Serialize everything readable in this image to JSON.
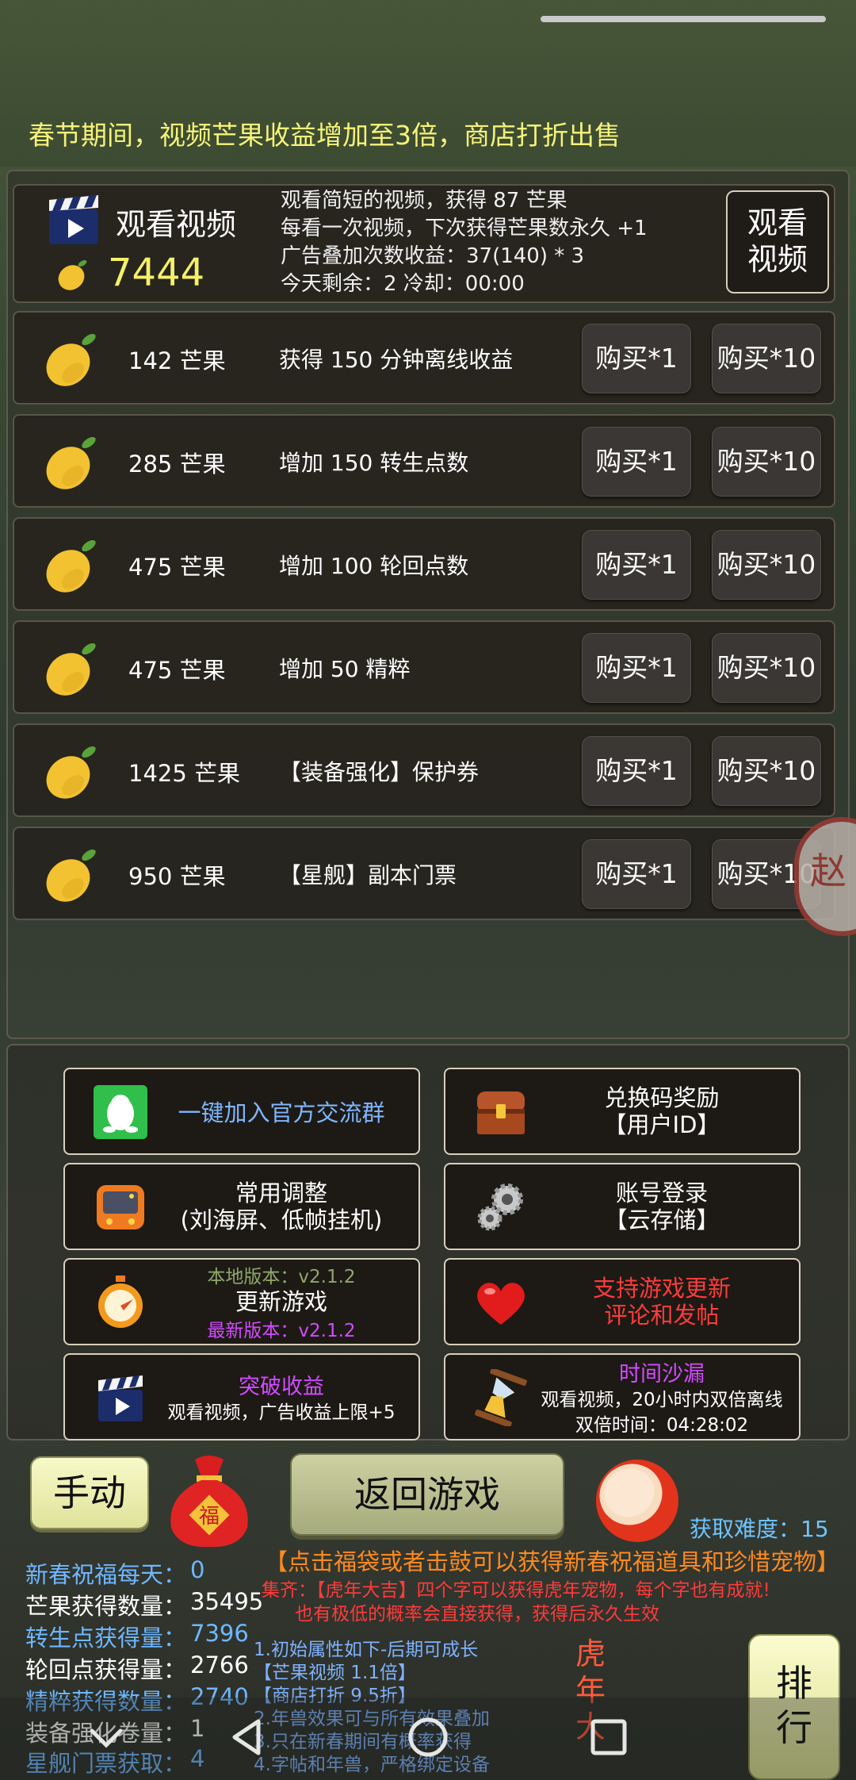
{
  "announcement": "春节期间，视频芒果收益增加至3倍，商店打折出售",
  "video": {
    "title": "观看视频",
    "mango_count": "7444",
    "lines": [
      "观看简短的视频，获得 87 芒果",
      "每看一次视频，下次获得芒果数永久 +1",
      "广告叠加次数收益：37(140) * 3",
      "今天剩余：2    冷却：00:00"
    ],
    "button_lines": [
      "观看",
      "视频"
    ]
  },
  "shop": [
    {
      "price": "142 芒果",
      "effect": "获得 150 分钟离线收益",
      "buy1": "购买*1",
      "buy10": "购买*10"
    },
    {
      "price": "285 芒果",
      "effect": "增加 150 转生点数",
      "buy1": "购买*1",
      "buy10": "购买*10"
    },
    {
      "price": "475 芒果",
      "effect": "增加 100 轮回点数",
      "buy1": "购买*1",
      "buy10": "购买*10"
    },
    {
      "price": "475 芒果",
      "effect": "增加 50 精粹",
      "buy1": "购买*1",
      "buy10": "购买*10"
    },
    {
      "price": "1425 芒果",
      "effect": "【装备强化】保护券",
      "buy1": "购买*1",
      "buy10": "购买*10"
    },
    {
      "price": "950 芒果",
      "effect": "【星舰】副本门票",
      "buy1": "购买*1",
      "buy10": "购买*10"
    }
  ],
  "side_badge": "赵",
  "menu": {
    "join_group": "一键加入官方交流群",
    "redeem": [
      "兑换码奖励",
      "【用户ID】"
    ],
    "settings": [
      "常用调整",
      "(刘海屏、低帧挂机)"
    ],
    "login": [
      "账号登录",
      "【云存储】"
    ],
    "update": {
      "local": "本地版本：v2.1.2",
      "title": "更新游戏",
      "latest": "最新版本：v2.1.2"
    },
    "support": [
      "支持游戏更新",
      "评论和发帖"
    ],
    "breakthrough": {
      "title": "突破收益",
      "desc": "观看视频，广告收益上限+5"
    },
    "hourglass": {
      "title": "时间沙漏",
      "desc": "观看视频，20小时内双倍离线",
      "time": "双倍时间：04:28:02"
    }
  },
  "controls": {
    "manual": "手动",
    "bag_char": "福",
    "return": "返回游戏",
    "difficulty": "获取难度：15",
    "rank": [
      "排",
      "行"
    ]
  },
  "hint_main": "【点击福袋或者击鼓可以获得新春祝福道具和珍惜宠物】",
  "hint_collect": [
    "集齐：【虎年大吉】四个字可以获得虎年宠物，每个字也有成就!",
    "也有极低的概率会直接获得，获得后永久生效"
  ],
  "stats": [
    {
      "label": "新春祝福每天：",
      "value": "0",
      "color": "blue"
    },
    {
      "label": "芒果获得数量：",
      "value": "35495",
      "color": "white"
    },
    {
      "label": "转生点获得量：",
      "value": "7396",
      "color": "blue"
    },
    {
      "label": "轮回点获得量：",
      "value": "2766",
      "color": "white"
    },
    {
      "label": "精粹获得数量：",
      "value": "2740",
      "color": "blue"
    },
    {
      "label": "装备强化卷量：",
      "value": "1",
      "color": "white"
    },
    {
      "label": "星舰门票获取：",
      "value": "4",
      "color": "blue"
    }
  ],
  "rules": [
    "1.初始属性如下-后期可成长",
    "【芒果视频 1.1倍】",
    "【商店打折 9.5折】",
    "2.年兽效果可与所有效果叠加",
    "3.只在新春期间有概率获得",
    "4.字帖和年兽，严格绑定设备"
  ],
  "tiger_chars": [
    "虎",
    "年",
    "大"
  ]
}
